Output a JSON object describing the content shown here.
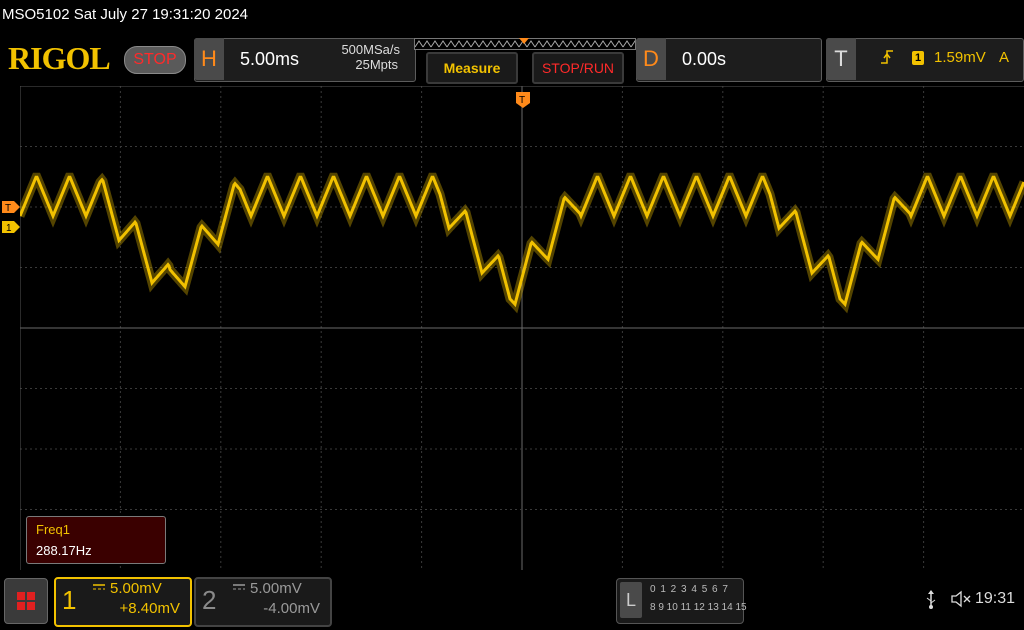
{
  "title_bar": {
    "text": "MSO5102  Sat July 27 19:31:20 2024"
  },
  "toolbar": {
    "logo": "RIGOL",
    "run_state": "STOP",
    "horizontal": {
      "letter": "H",
      "timebase": "5.00ms",
      "sample_rate": "500MSa/s",
      "memory_depth": "25Mpts"
    },
    "measure_label": "Measure",
    "stoprun_label": "STOP/RUN",
    "delay": {
      "letter": "D",
      "value": "0.00s"
    },
    "trigger": {
      "letter": "T",
      "edge": "rising",
      "source": "1",
      "level": "1.59mV",
      "mode": "A"
    }
  },
  "screen": {
    "markers": {
      "trigger_level": "T",
      "channel1": "1",
      "trigger_top": "T"
    },
    "measurement": {
      "label": "Freq1",
      "value": "288.17Hz"
    }
  },
  "channels": [
    {
      "number": "1",
      "scale": "5.00mV",
      "offset": "+8.40mV",
      "color": "#f2c200",
      "active": true
    },
    {
      "number": "2",
      "scale": "5.00mV",
      "offset": "-4.00mV",
      "color": "#9a9a9a",
      "active": false
    }
  ],
  "logic_analyzer": {
    "letter": "L",
    "row1": "0 1 2 3   4 5 6 7",
    "row2": "8 9 10 11 12 13 14 15"
  },
  "status": {
    "clock": "19:31",
    "usb_icon": "usb-icon",
    "sound_icon": "speaker-muted-icon"
  },
  "colors": {
    "ch1": "#f2c200",
    "accent": "#ff8a1a",
    "stop": "#ff2a2a"
  }
}
